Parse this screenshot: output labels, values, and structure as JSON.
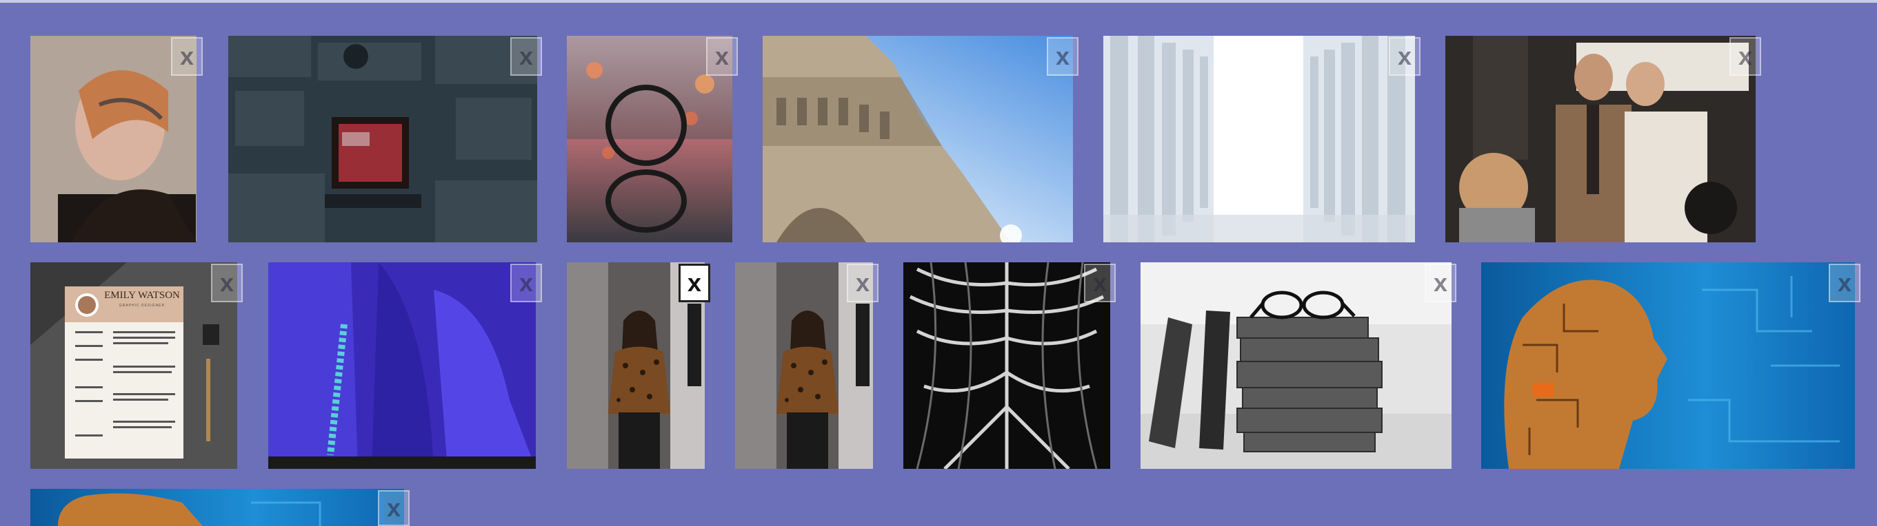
{
  "close_label": "x",
  "gallery": {
    "row1": [
      {
        "name": "woman-braided-hair",
        "colors": [
          "#b7a79a",
          "#3a2a24",
          "#c57a4a"
        ]
      },
      {
        "name": "stone-wall-sign",
        "colors": [
          "#2a3a44",
          "#4c5a62",
          "#8a2a30"
        ]
      },
      {
        "name": "bokeh-ring",
        "colors": [
          "#f0b0b8",
          "#2c4a50",
          "#e07048"
        ]
      },
      {
        "name": "cathedral-facade",
        "colors": [
          "#9ec7f0",
          "#c8b8a0",
          "#6e6050"
        ]
      },
      {
        "name": "white-columns",
        "colors": [
          "#eef2f6",
          "#c4ccd6",
          "#ffffff"
        ]
      },
      {
        "name": "street-scene-men",
        "colors": [
          "#3a3430",
          "#8a6a4e",
          "#e6e0d6"
        ]
      }
    ],
    "row2": [
      {
        "name": "resume-document",
        "colors": [
          "#3a3a3a",
          "#f2efe8",
          "#caa88a"
        ],
        "resume_name": "EMILY WATSON",
        "resume_role": "GRAPHIC DESIGNER"
      },
      {
        "name": "blue-skin-pattern",
        "colors": [
          "#3c2cc0",
          "#5648e0",
          "#2a2a2a"
        ]
      },
      {
        "name": "woman-leopard-top",
        "colors": [
          "#7a7676",
          "#3a2a1a",
          "#c8c4c4"
        ]
      },
      {
        "name": "woman-leopard-top-copy",
        "colors": [
          "#7a7676",
          "#3a2a1a",
          "#c8c4c4"
        ]
      },
      {
        "name": "fractal-pattern",
        "colors": [
          "#0a0a0a",
          "#d0d0d0",
          "#5a5a5a"
        ]
      },
      {
        "name": "books-glasses",
        "colors": [
          "#e8e8e8",
          "#555555",
          "#2c2c2c"
        ]
      },
      {
        "name": "circuit-head",
        "colors": [
          "#1e8ed6",
          "#0a5a9c",
          "#d88a3a"
        ]
      }
    ],
    "row3": [
      {
        "name": "circuit-head-partial",
        "colors": [
          "#1e8ed6",
          "#0a5a9c",
          "#d88a3a"
        ]
      }
    ]
  }
}
